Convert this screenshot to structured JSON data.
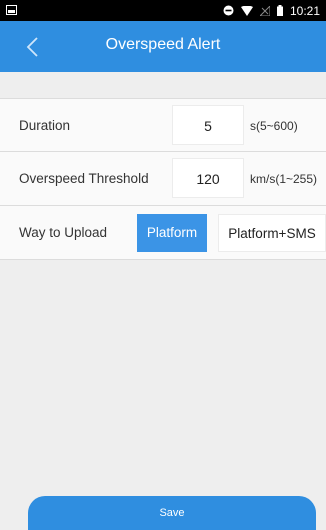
{
  "status_bar": {
    "time": "10:21",
    "icons": [
      "notification-icon",
      "do-not-disturb-icon",
      "wifi-icon",
      "signal-icon",
      "battery-icon"
    ]
  },
  "header": {
    "title": "Overspeed Alert",
    "back_icon": "chevron-left-icon",
    "color": "#2f8ee0"
  },
  "form": {
    "duration": {
      "label": "Duration",
      "value": "5",
      "unit": "s(5~600)"
    },
    "threshold": {
      "label": "Overspeed Threshold",
      "value": "120",
      "unit": "km/s(1~255)"
    },
    "upload": {
      "label": "Way to Upload",
      "options": [
        {
          "label": "Platform",
          "selected": true
        },
        {
          "label": "Platform+SMS",
          "selected": false
        }
      ]
    }
  },
  "save_button": {
    "label": "Save"
  },
  "colors": {
    "accent": "#2f8ee0",
    "selected_option": "#3b94e6",
    "background": "#eeeeee"
  }
}
